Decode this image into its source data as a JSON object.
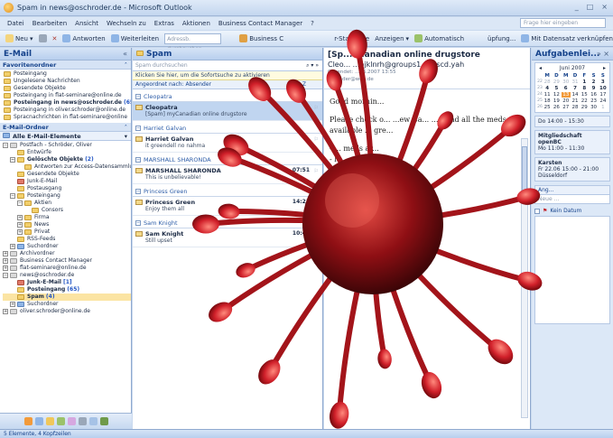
{
  "window": {
    "title": "Spam in news@oschroder.de - Microsoft Outlook",
    "min": "_",
    "max": "□",
    "close": "×"
  },
  "menu": [
    "Datei",
    "Bearbeiten",
    "Ansicht",
    "Wechseln zu",
    "Extras",
    "Aktionen",
    "Business Contact Manager",
    "?"
  ],
  "help_placeholder": "Frage hier eingeben",
  "toolbar": {
    "new": "Neu",
    "reply": "Antworten",
    "forward": "Weiterleiten",
    "search_placeholder": "Adressb. durchsuchen",
    "business": "Business C",
    "startpage": "r-Startseite",
    "views": "Anzeigen",
    "automatic": "Automatisch",
    "pruefung": "üpfung...",
    "link": "Mit Datensatz verknüpfen"
  },
  "nav": {
    "title": "E-Mail",
    "favorites_header": "Favoritenordner",
    "favorites": [
      {
        "label": "Posteingang",
        "count": "",
        "bold": false
      },
      {
        "label": "Ungelesene Nachrichten",
        "count": "",
        "bold": false
      },
      {
        "label": "Gesendete Objekte",
        "count": "",
        "bold": false
      },
      {
        "label": "Posteingang in flat-seminare@online.de",
        "count": "",
        "bold": false
      },
      {
        "label": "Posteingang in news@oschroder.de",
        "count": "(65)",
        "bold": true
      },
      {
        "label": "Posteingang in oliver.schroder@online.de",
        "count": "",
        "bold": false
      },
      {
        "label": "Spracnachrichten in flat-seminare@online",
        "count": "",
        "bold": false
      }
    ],
    "folders_header": "E-Mail-Ordner",
    "all_items": "Alle E-Mail-Elemente",
    "tree": [
      {
        "label": "Postfach - Schröder, Oliver",
        "indent": 0,
        "exp": "-",
        "bold": false,
        "count": "",
        "icon": "grey"
      },
      {
        "label": "Entwürfe",
        "indent": 1,
        "exp": "",
        "bold": false,
        "count": "",
        "icon": ""
      },
      {
        "label": "Gelöschte Objekte",
        "indent": 1,
        "exp": "-",
        "bold": true,
        "count": "(2)",
        "icon": ""
      },
      {
        "label": "Antworten zur Access-Datensammlu",
        "indent": 2,
        "exp": "",
        "bold": false,
        "count": "",
        "icon": ""
      },
      {
        "label": "Gesendete Objekte",
        "indent": 1,
        "exp": "",
        "bold": false,
        "count": "",
        "icon": ""
      },
      {
        "label": "Junk-E-Mail",
        "indent": 1,
        "exp": "",
        "bold": false,
        "count": "",
        "icon": "red"
      },
      {
        "label": "Postausgang",
        "indent": 1,
        "exp": "",
        "bold": false,
        "count": "",
        "icon": ""
      },
      {
        "label": "Posteingang",
        "indent": 1,
        "exp": "-",
        "bold": false,
        "count": "",
        "icon": ""
      },
      {
        "label": "Aktien",
        "indent": 2,
        "exp": "-",
        "bold": false,
        "count": "",
        "icon": ""
      },
      {
        "label": "Consors",
        "indent": 3,
        "exp": "",
        "bold": false,
        "count": "",
        "icon": ""
      },
      {
        "label": "Firma",
        "indent": 2,
        "exp": "+",
        "bold": false,
        "count": "",
        "icon": ""
      },
      {
        "label": "News",
        "indent": 2,
        "exp": "+",
        "bold": false,
        "count": "",
        "icon": ""
      },
      {
        "label": "Privat",
        "indent": 2,
        "exp": "+",
        "bold": false,
        "count": "",
        "icon": ""
      },
      {
        "label": "RSS-Feeds",
        "indent": 1,
        "exp": "",
        "bold": false,
        "count": "",
        "icon": ""
      },
      {
        "label": "Suchordner",
        "indent": 1,
        "exp": "+",
        "bold": false,
        "count": "",
        "icon": "blue"
      },
      {
        "label": "Archivordner",
        "indent": 0,
        "exp": "+",
        "bold": false,
        "count": "",
        "icon": "grey"
      },
      {
        "label": "Business Contact Manager",
        "indent": 0,
        "exp": "+",
        "bold": false,
        "count": "",
        "icon": "grey"
      },
      {
        "label": "flat-seminare@online.de",
        "indent": 0,
        "exp": "+",
        "bold": false,
        "count": "",
        "icon": "grey"
      },
      {
        "label": "news@oschroder.de",
        "indent": 0,
        "exp": "-",
        "bold": false,
        "count": "",
        "icon": "grey"
      },
      {
        "label": "Junk-E-Mail",
        "indent": 1,
        "exp": "",
        "bold": true,
        "count": "[1]",
        "icon": "red"
      },
      {
        "label": "Posteingang",
        "indent": 1,
        "exp": "",
        "bold": true,
        "count": "(65)",
        "icon": ""
      },
      {
        "label": "Spam",
        "indent": 1,
        "exp": "",
        "bold": true,
        "count": "(4)",
        "icon": "",
        "selected": true
      },
      {
        "label": "Suchordner",
        "indent": 1,
        "exp": "+",
        "bold": false,
        "count": "",
        "icon": "blue"
      },
      {
        "label": "oliver.schroder@online.de",
        "indent": 0,
        "exp": "+",
        "bold": false,
        "count": "",
        "icon": "grey"
      }
    ]
  },
  "list": {
    "title": "Spam",
    "search_placeholder": "Spam durchsuchen",
    "hint": "Klicken Sie hier, um die Sofortsuche zu aktivieren",
    "sort_label": "Angeordnet nach: Absender",
    "sort_order": "A-Z",
    "groups": [
      {
        "name": "Cleopatra",
        "messages": [
          {
            "from": "Cleopatra",
            "subject": "[Spam] myCanadian online drugstore",
            "time": "",
            "selected": true
          }
        ]
      },
      {
        "name": "Harriet Galvan",
        "messages": [
          {
            "from": "Harriet Galvan",
            "subject": "it greendell no nahma",
            "time": ""
          }
        ]
      },
      {
        "name": "MARSHALL SHARONDA",
        "messages": [
          {
            "from": "MARSHALL SHARONDA",
            "subject": "This is unbelievable!",
            "time": "07:51"
          }
        ]
      },
      {
        "name": "Princess Green",
        "messages": [
          {
            "from": "Princess Green",
            "subject": "Enjoy them all",
            "time": "14:21"
          }
        ]
      },
      {
        "name": "Sam Knight",
        "messages": [
          {
            "from": "Sam Knight",
            "subject": "Still upset",
            "time": "10:49"
          }
        ]
      }
    ]
  },
  "reading": {
    "subject": "[Sp... ...anadian online drugstore",
    "from": "Cleo... ...bjklnrh@groups1.vip.scd.yah",
    "sent_label": "Gesendet:",
    "sent_value": "...06.2007 13:55",
    "to_label": "An:",
    "to_value": "...der@web.de",
    "body": [
      "Good mornin...",
      "Please check o... ...ew Ca... ...d find all the meds available ... gre...",
      "- ... meds ar...",
      "- lo...",
      "- 24/...",
      "- v..."
    ]
  },
  "todo": {
    "title": "Aufgabenlei...",
    "month": "Juni 2007",
    "days": [
      "M",
      "D",
      "M",
      "D",
      "F",
      "S",
      "S"
    ],
    "weeks": [
      {
        "wk": "22",
        "d": [
          "28",
          "29",
          "30",
          "31",
          "1",
          "2",
          "3"
        ],
        "muted": [
          0,
          1,
          2,
          3
        ],
        "bold": [
          4,
          5,
          6
        ]
      },
      {
        "wk": "23",
        "d": [
          "4",
          "5",
          "6",
          "7",
          "8",
          "9",
          "10"
        ],
        "muted": [],
        "bold": [
          0,
          1,
          2,
          3,
          4,
          5,
          6
        ]
      },
      {
        "wk": "24",
        "d": [
          "11",
          "12",
          "13",
          "14",
          "15",
          "16",
          "17"
        ],
        "muted": [],
        "bold": [],
        "today": 2
      },
      {
        "wk": "25",
        "d": [
          "18",
          "19",
          "20",
          "21",
          "22",
          "23",
          "24"
        ],
        "muted": [],
        "bold": []
      },
      {
        "wk": "26",
        "d": [
          "25",
          "26",
          "27",
          "28",
          "29",
          "30",
          "1"
        ],
        "muted": [
          6
        ],
        "bold": []
      }
    ],
    "appointments": [
      {
        "title": "",
        "time": "Do 14:00 - 15:30"
      },
      {
        "title": "Mitgliedschaft openBC",
        "time": "Mo 11:00 - 11:30"
      },
      {
        "title": "Karsten",
        "time": "Fr 22.06 15:00 - 21:00",
        "extra": "Düsseldorf"
      }
    ],
    "tasks_header": "Ang...",
    "new_task": "Neue ...",
    "due_label": "Kein Datum"
  },
  "status": "5 Elemente, 4 Kopfzeilen",
  "colors": {
    "accent": "#15428b",
    "virus": "#c0161d"
  }
}
